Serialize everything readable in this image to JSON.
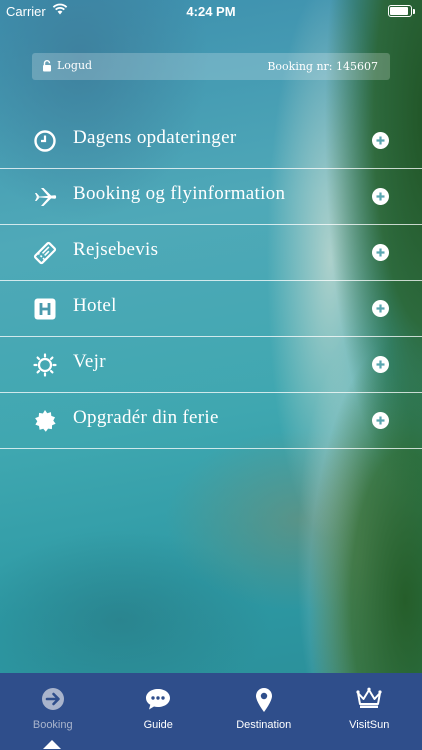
{
  "status_bar": {
    "carrier": "Carrier",
    "time": "4:24 PM",
    "battery_level": 1.0
  },
  "info_bar": {
    "logout_label": "Logud",
    "booking_label": "Booking nr: 145607"
  },
  "menu": {
    "items": [
      {
        "label": "Dagens opdateringer",
        "icon": "clock-icon"
      },
      {
        "label": "Booking og flyinformation",
        "icon": "airplane-icon"
      },
      {
        "label": "Rejsebevis",
        "icon": "ticket-icon"
      },
      {
        "label": "Hotel",
        "icon": "hotel-icon"
      },
      {
        "label": "Vejr",
        "icon": "sun-icon"
      },
      {
        "label": "Opgradér din ferie",
        "icon": "badge-icon"
      }
    ]
  },
  "tab_bar": {
    "active_index": 0,
    "tabs": [
      {
        "label": "Booking",
        "icon": "arrow-circle-icon"
      },
      {
        "label": "Guide",
        "icon": "chat-icon"
      },
      {
        "label": "Destination",
        "icon": "map-pin-icon"
      },
      {
        "label": "VisitSun",
        "icon": "crown-icon"
      }
    ]
  },
  "colors": {
    "tab_bar_bg": "#2f4e8b",
    "inactive_tab_label": "#a9b4cc"
  }
}
